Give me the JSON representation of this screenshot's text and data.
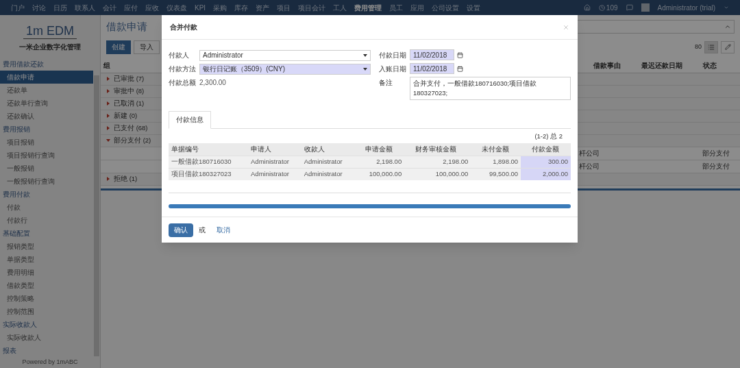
{
  "top_nav": {
    "items": [
      {
        "label": "门户",
        "selected": false
      },
      {
        "label": "讨论",
        "selected": false
      },
      {
        "label": "日历",
        "selected": false
      },
      {
        "label": "联系人",
        "selected": false
      },
      {
        "label": "会计",
        "selected": false
      },
      {
        "label": "应付",
        "selected": false
      },
      {
        "label": "应收",
        "selected": false
      },
      {
        "label": "仪表盘",
        "selected": false
      },
      {
        "label": "KPI",
        "selected": false
      },
      {
        "label": "采购",
        "selected": false
      },
      {
        "label": "库存",
        "selected": false
      },
      {
        "label": "资产",
        "selected": false
      },
      {
        "label": "项目",
        "selected": false
      },
      {
        "label": "项目会计",
        "selected": false
      },
      {
        "label": "工人",
        "selected": false
      },
      {
        "label": "费用管理",
        "selected": true
      },
      {
        "label": "员工",
        "selected": false
      },
      {
        "label": "应用",
        "selected": false
      },
      {
        "label": "公司设置",
        "selected": false
      },
      {
        "label": "设置",
        "selected": false
      }
    ],
    "notifications": "109",
    "user": "Administrator (trial)"
  },
  "sidebar": {
    "logo": "1m EDM",
    "tagline": "一米企业数字化管理",
    "sections": [
      {
        "title": "费用借款还款",
        "items": [
          {
            "label": "借款申请",
            "selected": true
          },
          {
            "label": "还款单",
            "selected": false
          },
          {
            "label": "还款单行查询",
            "selected": false
          },
          {
            "label": "还款确认",
            "selected": false
          }
        ]
      },
      {
        "title": "费用报销",
        "items": [
          {
            "label": "项目报销",
            "selected": false
          },
          {
            "label": "项目报销行查询",
            "selected": false
          },
          {
            "label": "一般报销",
            "selected": false
          },
          {
            "label": "一般报销行查询",
            "selected": false
          }
        ]
      },
      {
        "title": "费用付款",
        "items": [
          {
            "label": "付款",
            "selected": false
          },
          {
            "label": "付款行",
            "selected": false
          }
        ]
      },
      {
        "title": "基础配置",
        "items": [
          {
            "label": "报销类型",
            "selected": false
          },
          {
            "label": "单据类型",
            "selected": false
          },
          {
            "label": "费用明细",
            "selected": false
          },
          {
            "label": "借款类型",
            "selected": false
          },
          {
            "label": "控制策略",
            "selected": false
          },
          {
            "label": "控制范围",
            "selected": false
          }
        ]
      },
      {
        "title": "实际收款人",
        "items": [
          {
            "label": "实际收款人",
            "selected": false
          }
        ]
      },
      {
        "title": "报表"
      }
    ],
    "footer": "Powered by 1mABC"
  },
  "page": {
    "title": "借款申请",
    "buttons": [
      "创建",
      "导入"
    ],
    "pager": "80",
    "columns": [
      "组",
      "借款事由",
      "最迟还款日期",
      "状态"
    ],
    "groups": [
      {
        "label": "已审批 (7)",
        "expanded": false
      },
      {
        "label": "审批中 (8)",
        "expanded": false
      },
      {
        "label": "已取消 (1)",
        "expanded": false
      },
      {
        "label": "新建 (0)",
        "expanded": false
      },
      {
        "label": "已支付 (68)",
        "expanded": false
      },
      {
        "label": "部分支付 (2)",
        "expanded": true,
        "rows": [
          {
            "company": "杆公司",
            "status": "部分支付"
          },
          {
            "company": "杆公司",
            "status": "部分支付"
          }
        ]
      },
      {
        "label": "拒绝 (1)",
        "expanded": false
      }
    ]
  },
  "dialog": {
    "title": "合并付款",
    "left_fields": [
      {
        "label": "付款人",
        "kind": "select",
        "value": "Administrator",
        "required": false
      },
      {
        "label": "付款方法",
        "kind": "select",
        "value": "银行日记账（3509）(CNY)",
        "required": true
      },
      {
        "label": "付款总额",
        "kind": "text",
        "value": "2,300.00",
        "required": false
      }
    ],
    "right_fields": [
      {
        "label": "付款日期",
        "kind": "date",
        "value": "11/02/2018",
        "required": true
      },
      {
        "label": "入账日期",
        "kind": "date",
        "value": "11/02/2018",
        "required": true
      },
      {
        "label": "备注",
        "kind": "textarea",
        "value": "合并支付，一般借款180716030;项目借款180327023;",
        "required": false
      }
    ],
    "tabs": [
      {
        "label": "付款信息",
        "selected": true
      }
    ],
    "pager": "(1-2) 总 2",
    "table": {
      "columns": [
        "单据编号",
        "申请人",
        "收款人",
        "申请金额",
        "财务审核金额",
        "未付金额",
        "付款金额"
      ],
      "rows": [
        [
          "一般借款180716030",
          "Administrator",
          "Administrator",
          "2,198.00",
          "2,198.00",
          "1,898.00",
          "300.00"
        ],
        [
          "项目借款180327023",
          "Administrator",
          "Administrator",
          "100,000.00",
          "100,000.00",
          "99,500.00",
          "2,000.00"
        ]
      ]
    },
    "confirm": "确认",
    "or": "或",
    "cancel": "取消"
  }
}
